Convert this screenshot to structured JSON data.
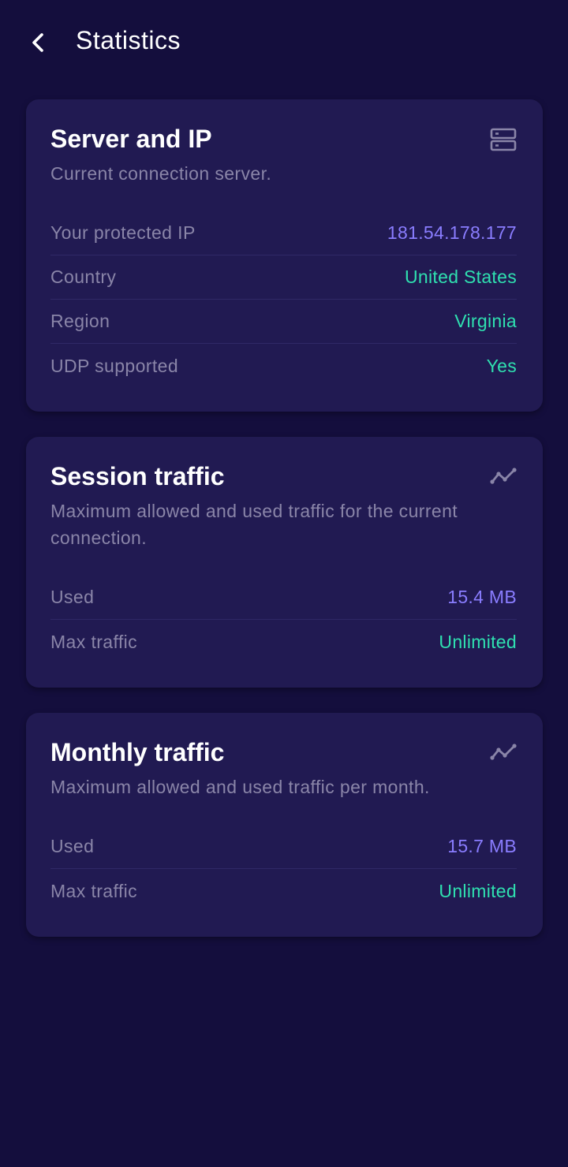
{
  "header": {
    "title": "Statistics",
    "back_icon": "chevron-left-icon"
  },
  "colors": {
    "background": "#140e3d",
    "card": "#211a52",
    "muted_text": "#8a85a8",
    "accent_purple": "#8a7dff",
    "accent_teal": "#2fe0b0"
  },
  "server_card": {
    "title": "Server and IP",
    "icon": "server-icon",
    "description": "Current connection server.",
    "rows": [
      {
        "label": "Your protected IP",
        "value": "181.54.178.177"
      },
      {
        "label": "Country",
        "value": "United States"
      },
      {
        "label": "Region",
        "value": "Virginia"
      },
      {
        "label": "UDP supported",
        "value": "Yes"
      }
    ]
  },
  "session_card": {
    "title": "Session traffic",
    "icon": "trend-line-icon",
    "description": "Maximum allowed and used traffic for the current connection.",
    "rows": [
      {
        "label": "Used",
        "value": "15.4 MB"
      },
      {
        "label": "Max traffic",
        "value": "Unlimited"
      }
    ]
  },
  "monthly_card": {
    "title": "Monthly traffic",
    "icon": "trend-line-icon",
    "description": "Maximum allowed and used traffic per month.",
    "rows": [
      {
        "label": "Used",
        "value": "15.7 MB"
      },
      {
        "label": "Max traffic",
        "value": "Unlimited"
      }
    ]
  }
}
